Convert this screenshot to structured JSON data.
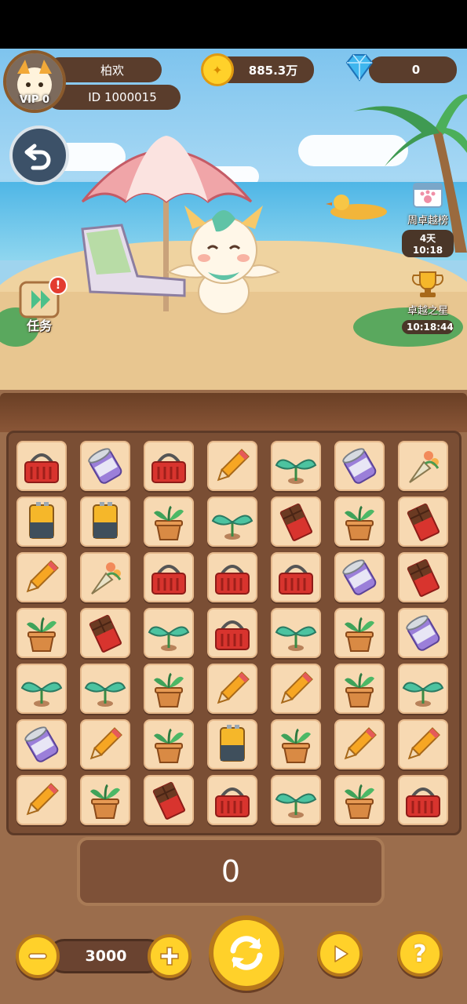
{
  "player": {
    "name": "柏欢",
    "id_text": "ID 1000015",
    "vip_text": "VIP 0"
  },
  "currency": {
    "coins": "885.3万",
    "gems": "0"
  },
  "side_events": [
    {
      "label": "周卓越榜",
      "timer": "4天10:18",
      "icon": "calendar-paw-icon"
    },
    {
      "label": "卓越之星",
      "timer": "10:18:44",
      "icon": "trophy-icon"
    }
  ],
  "task_button": {
    "label": "任务",
    "has_alert": true
  },
  "board": {
    "rows": [
      [
        "basket",
        "can",
        "basket",
        "pencil",
        "sprout",
        "can",
        "bouquet"
      ],
      [
        "battery",
        "battery",
        "pot",
        "sprout",
        "chocolate",
        "pot",
        "chocolate"
      ],
      [
        "pencil",
        "bouquet",
        "basket",
        "basket",
        "basket",
        "can",
        "chocolate"
      ],
      [
        "pot",
        "chocolate",
        "sprout",
        "basket",
        "sprout",
        "pot",
        "can"
      ],
      [
        "sprout",
        "sprout",
        "pot",
        "pencil",
        "pencil",
        "pot",
        "sprout"
      ],
      [
        "can",
        "pencil",
        "pot",
        "battery",
        "pot",
        "pencil",
        "pencil"
      ],
      [
        "pencil",
        "pot",
        "chocolate",
        "basket",
        "sprout",
        "pot",
        "basket"
      ]
    ]
  },
  "tray": {
    "score": "0"
  },
  "controls": {
    "bet": "3000"
  },
  "colors": {
    "board_bg": "#7a4e34",
    "tile_bg": "#f7d9b2",
    "button_yellow": "#ffd12a"
  }
}
